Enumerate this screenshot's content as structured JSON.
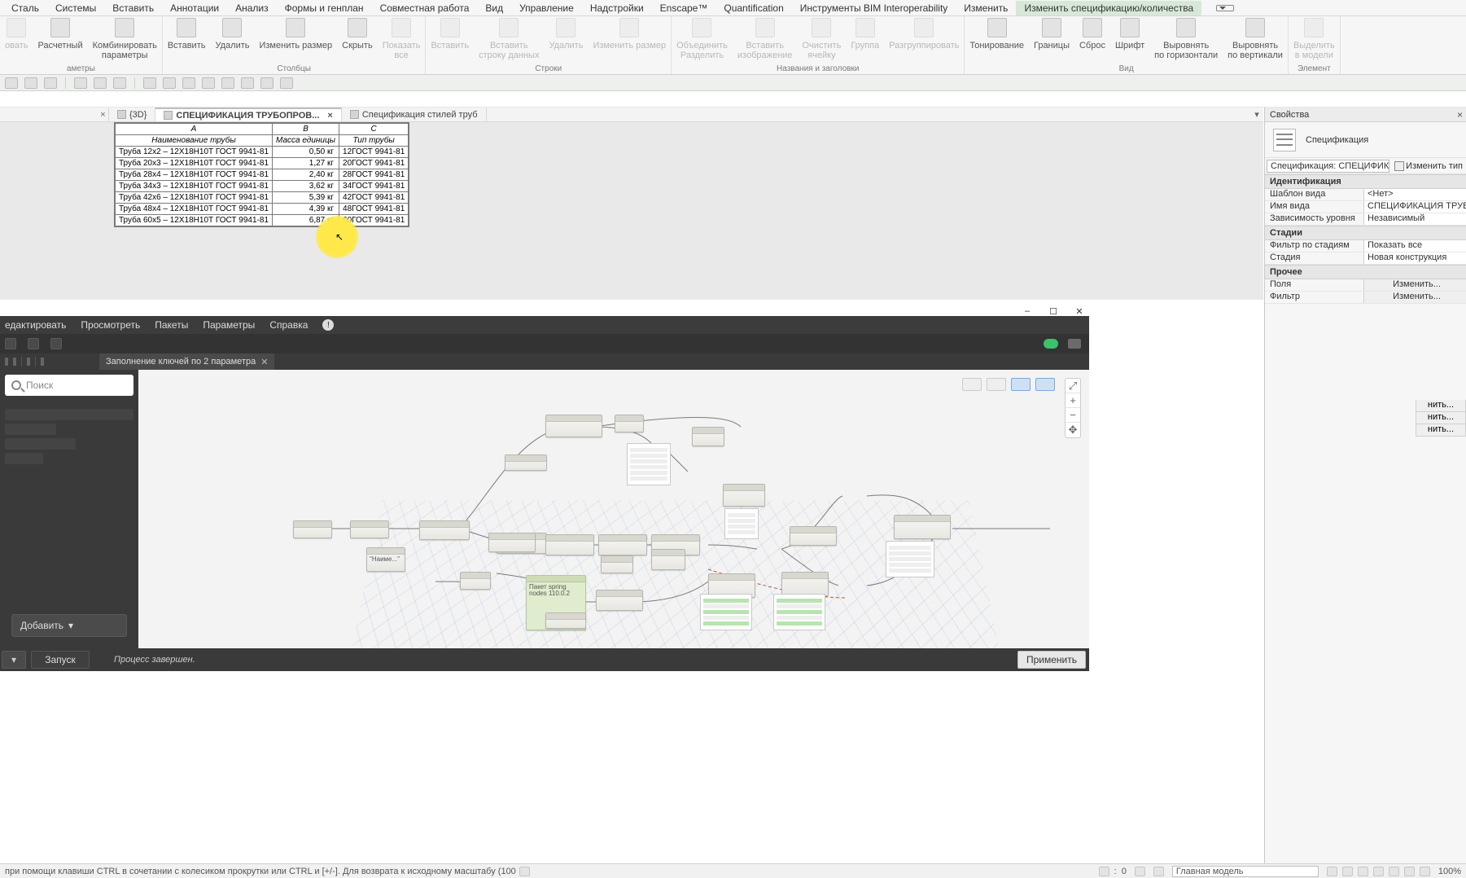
{
  "menu": [
    "Сталь",
    "Системы",
    "Вставить",
    "Аннотации",
    "Анализ",
    "Формы и генплан",
    "Совместная работа",
    "Вид",
    "Управление",
    "Надстройки",
    "Enscape™",
    "Quantification",
    "Инструменты BIM Interoperability",
    "Изменить",
    "Изменить спецификацию/количества"
  ],
  "menu_active_index": 14,
  "ribbon": {
    "panels": [
      {
        "name": "аметры",
        "items": [
          {
            "label": "овать",
            "dis": true
          },
          {
            "label": "Расчетный"
          },
          {
            "label": "Комбинировать\nпараметры"
          }
        ]
      },
      {
        "name": "Столбцы",
        "items": [
          {
            "label": "Вставить"
          },
          {
            "label": "Удалить"
          },
          {
            "label": "Изменить размер"
          },
          {
            "label": "Скрыть"
          },
          {
            "label": "Показать\nвсе",
            "dis": true
          }
        ]
      },
      {
        "name": "Строки",
        "items": [
          {
            "label": "Вставить",
            "dis": true
          },
          {
            "label": "Вставить\nстроку данных",
            "dis": true
          },
          {
            "label": "Удалить",
            "dis": true
          },
          {
            "label": "Изменить размер",
            "dis": true
          }
        ]
      },
      {
        "name": "Названия и заголовки",
        "items": [
          {
            "label": "Объединить\nРазделить",
            "dis": true
          },
          {
            "label": "Вставить\nизображение",
            "dis": true
          },
          {
            "label": "Очистить\nячейку",
            "dis": true
          },
          {
            "label": "Группа",
            "dis": true
          },
          {
            "label": "Разгруппировать",
            "dis": true
          }
        ]
      },
      {
        "name": "Вид",
        "items": [
          {
            "label": "Тонирование"
          },
          {
            "label": "Границы"
          },
          {
            "label": "Сброс"
          },
          {
            "label": "Шрифт"
          },
          {
            "label": "Выровнять\nпо горизонтали"
          },
          {
            "label": "Выровнять\nпо вертикали"
          }
        ]
      },
      {
        "name": "Элемент",
        "items": [
          {
            "label": "Выделить\nв модели",
            "dis": true
          }
        ]
      }
    ]
  },
  "tabs": {
    "t1": "{3D}",
    "t2": "СПЕЦИФИКАЦИЯ ТРУБОПРОВ...",
    "t3": "Спецификация стилей труб"
  },
  "schedule": {
    "colLetters": [
      "A",
      "B",
      "C"
    ],
    "headers": [
      "Наименование трубы",
      "Масса единицы",
      "Тип трубы"
    ],
    "rows": [
      [
        "Труба 12x2 – 12Х18Н10Т ГОСТ 9941-81",
        "0,50 кг",
        "12ГОСТ 9941-81"
      ],
      [
        "Труба 20x3 – 12Х18Н10Т ГОСТ 9941-81",
        "1,27 кг",
        "20ГОСТ 9941-81"
      ],
      [
        "Труба 28x4 – 12Х18Н10Т ГОСТ 9941-81",
        "2,40 кг",
        "28ГОСТ 9941-81"
      ],
      [
        "Труба 34x3 – 12Х18Н10Т ГОСТ 9941-81",
        "3,62 кг",
        "34ГОСТ 9941-81"
      ],
      [
        "Труба 42x6 – 12Х18Н10Т ГОСТ 9941-81",
        "5,39 кг",
        "42ГОСТ 9941-81"
      ],
      [
        "Труба 48x4 – 12Х18Н10Т ГОСТ 9941-81",
        "4,39 кг",
        "48ГОСТ 9941-81"
      ],
      [
        "Труба 60x5 – 12Х18Н10Т ГОСТ 9941-81",
        "6,87 кг",
        "60ГОСТ 9941-81"
      ]
    ]
  },
  "props": {
    "title": "Свойства",
    "type_label": "Спецификация",
    "selector": "Спецификация: СПЕЦИФИКАЦИЯ Т",
    "edit_type": "Изменить тип",
    "groups": {
      "id_title": "Идентификация",
      "id_rows": [
        [
          "Шаблон вида",
          "<Нет>"
        ],
        [
          "Имя вида",
          "СПЕЦИФИКАЦИЯ ТРУБО..."
        ],
        [
          "Зависимость уровня",
          "Независимый"
        ]
      ],
      "stage_title": "Стадии",
      "stage_rows": [
        [
          "Фильтр по стадиям",
          "Показать все"
        ],
        [
          "Стадия",
          "Новая конструкция"
        ]
      ],
      "other_title": "Прочее",
      "other_rows": [
        [
          "Поля",
          "Изменить..."
        ],
        [
          "Фильтр",
          "Изменить..."
        ]
      ],
      "extra_edit": [
        "нить...",
        "нить...",
        "нить..."
      ]
    }
  },
  "dynamo": {
    "menu": [
      "едактировать",
      "Просмотреть",
      "Пакеты",
      "Параметры",
      "Справка"
    ],
    "tab": "Заполнение ключей по 2 параметра",
    "search_placeholder": "Поиск",
    "add": "Добавить",
    "run": "Запуск",
    "process_msg": "Процесс завершен.",
    "apply": "Применить",
    "note_title": "Пакет spring",
    "note_body": "nodes 110.0.2"
  },
  "status": {
    "hint": "при помощи клавиши CTRL в сочетании с колесиком прокрутки или CTRL и [+/-]. Для возврата к исходному масштабу (100",
    "num": "0",
    "main_model": "Главная модель",
    "zoom": "100%"
  }
}
